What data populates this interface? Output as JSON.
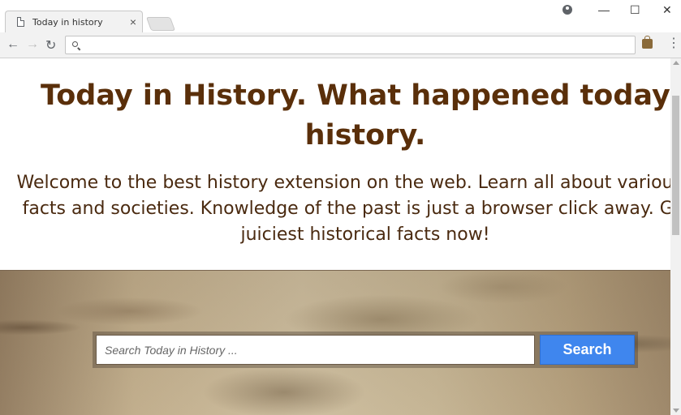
{
  "browser": {
    "tab_title": "Today in history",
    "tab_close": "×",
    "address_value": "",
    "window_controls": {
      "minimize": "—",
      "maximize": "☐",
      "close": "✕"
    },
    "nav": {
      "back": "←",
      "forward": "→",
      "reload": "↻"
    },
    "menu": "⋮"
  },
  "page": {
    "headline_line1": "Today in History. What happened today i",
    "headline_line2": "history.",
    "intro_line1": "Welcome to the best history extension on the web. Learn all about various his",
    "intro_line2": "facts and societies. Knowledge of the past is just a browser click away. Get a",
    "intro_line3": "juiciest historical facts now!",
    "search_placeholder": "Search Today in History ...",
    "search_button": "Search"
  },
  "colors": {
    "headline": "#5a2f0a",
    "intro_text": "#4a2a10",
    "search_button": "#3f86ee"
  },
  "icons": [
    "page-icon",
    "close-icon",
    "profile-icon",
    "minimize-icon",
    "maximize-icon",
    "window-close-icon",
    "back-icon",
    "forward-icon",
    "reload-icon",
    "search-icon",
    "extension-icon",
    "menu-icon"
  ]
}
